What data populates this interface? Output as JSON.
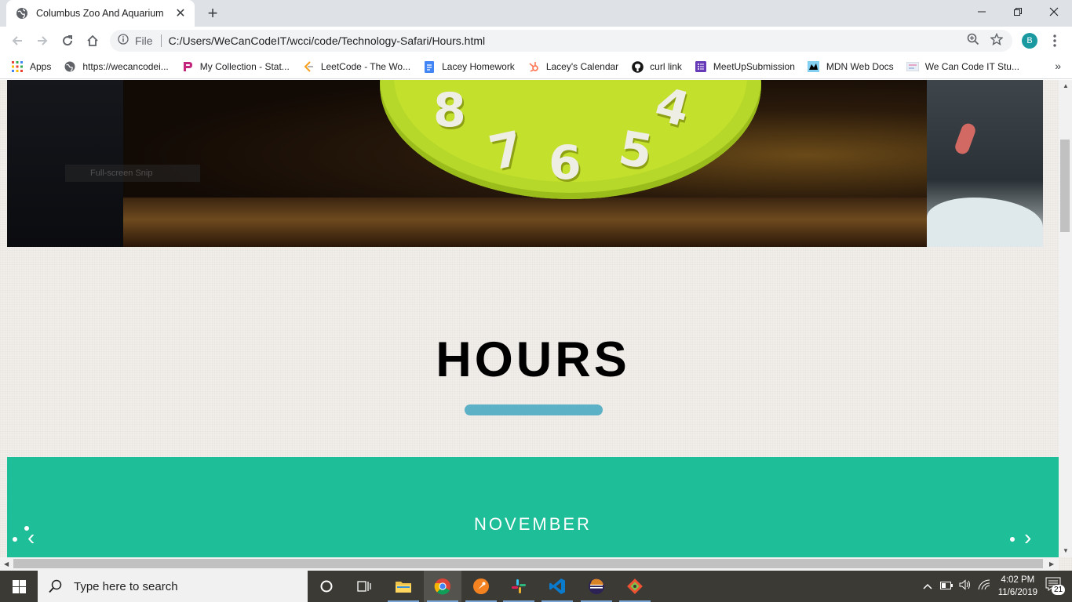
{
  "browser": {
    "tab_title": "Columbus Zoo And Aquarium",
    "new_tab": "+",
    "url_scheme_label": "File",
    "url": "C:/Users/WeCanCodeIT/wcci/code/Technology-Safari/Hours.html",
    "profile_initial": "B"
  },
  "bookmarks": [
    {
      "label": "Apps",
      "icon": "apps-grid-icon"
    },
    {
      "label": "https://wecancodei...",
      "icon": "globe-icon"
    },
    {
      "label": "My Collection - Stat...",
      "icon": "p-logo-icon"
    },
    {
      "label": "LeetCode - The Wo...",
      "icon": "leetcode-icon"
    },
    {
      "label": "Lacey Homework",
      "icon": "doc-icon"
    },
    {
      "label": "Lacey's Calendar",
      "icon": "hubspot-icon"
    },
    {
      "label": "curl link",
      "icon": "github-icon"
    },
    {
      "label": "MeetUpSubmission",
      "icon": "form-icon"
    },
    {
      "label": "MDN Web Docs",
      "icon": "mdn-icon"
    },
    {
      "label": "We Can Code IT Stu...",
      "icon": "wcci-icon"
    }
  ],
  "hero": {
    "clock_numbers": [
      "8",
      "7",
      "6",
      "5",
      "4"
    ],
    "snip_tooltip": "Full-screen Snip"
  },
  "page": {
    "hours_title": "HOURS",
    "month": "NOVEMBER",
    "prev_arrow": "‹",
    "next_arrow": "›"
  },
  "taskbar": {
    "search_placeholder": "Type here to search",
    "time": "4:02 PM",
    "date": "11/6/2019",
    "notification_count": "21"
  },
  "colors": {
    "calendar_bg": "#1dbe98",
    "underline": "#5db1c6",
    "page_bg": "#f1eeea",
    "taskbar_bg": "#3b3a35"
  }
}
